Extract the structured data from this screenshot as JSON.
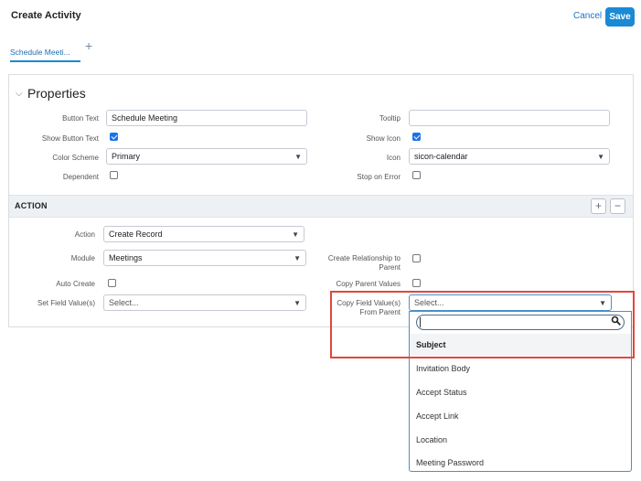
{
  "header": {
    "title": "Create Activity",
    "cancel_label": "Cancel",
    "save_label": "Save"
  },
  "tabs": [
    {
      "label": "Schedule Meeti..."
    }
  ],
  "properties": {
    "section_title": "Properties",
    "button_text": {
      "label": "Button Text",
      "value": "Schedule Meeting"
    },
    "tooltip": {
      "label": "Tooltip",
      "value": ""
    },
    "show_button_text": {
      "label": "Show Button Text",
      "checked": true
    },
    "show_icon": {
      "label": "Show Icon",
      "checked": true
    },
    "color_scheme": {
      "label": "Color Scheme",
      "value": "Primary"
    },
    "icon": {
      "label": "Icon",
      "value": "sicon-calendar"
    },
    "dependent": {
      "label": "Dependent",
      "checked": false
    },
    "stop_on_error": {
      "label": "Stop on Error",
      "checked": false
    }
  },
  "action": {
    "section_title": "ACTION",
    "action": {
      "label": "Action",
      "value": "Create Record"
    },
    "module": {
      "label": "Module",
      "value": "Meetings"
    },
    "create_relationship": {
      "label_line1": "Create Relationship to",
      "label_line2": "Parent",
      "checked": false
    },
    "auto_create": {
      "label": "Auto Create",
      "checked": false
    },
    "copy_parent_values": {
      "label": "Copy Parent Values",
      "checked": false
    },
    "set_field_values": {
      "label": "Set Field Value(s)",
      "value": "Select..."
    },
    "copy_field_values": {
      "label_line1": "Copy Field Value(s)",
      "label_line2": "From Parent",
      "value": "Select..."
    }
  },
  "dropdown": {
    "search_value": "",
    "options": [
      "Subject",
      "Invitation Body",
      "Accept Status",
      "Accept Link",
      "Location",
      "Meeting Password"
    ],
    "highlighted": "Subject"
  },
  "colors": {
    "accent": "#1a8ad4",
    "highlight_box": "#e2473a",
    "checkbox_checked": "#1a73e8"
  },
  "icons": [
    "plus-icon",
    "chevron-down-icon",
    "search-icon",
    "minus-icon",
    "checkbox-icon"
  ]
}
